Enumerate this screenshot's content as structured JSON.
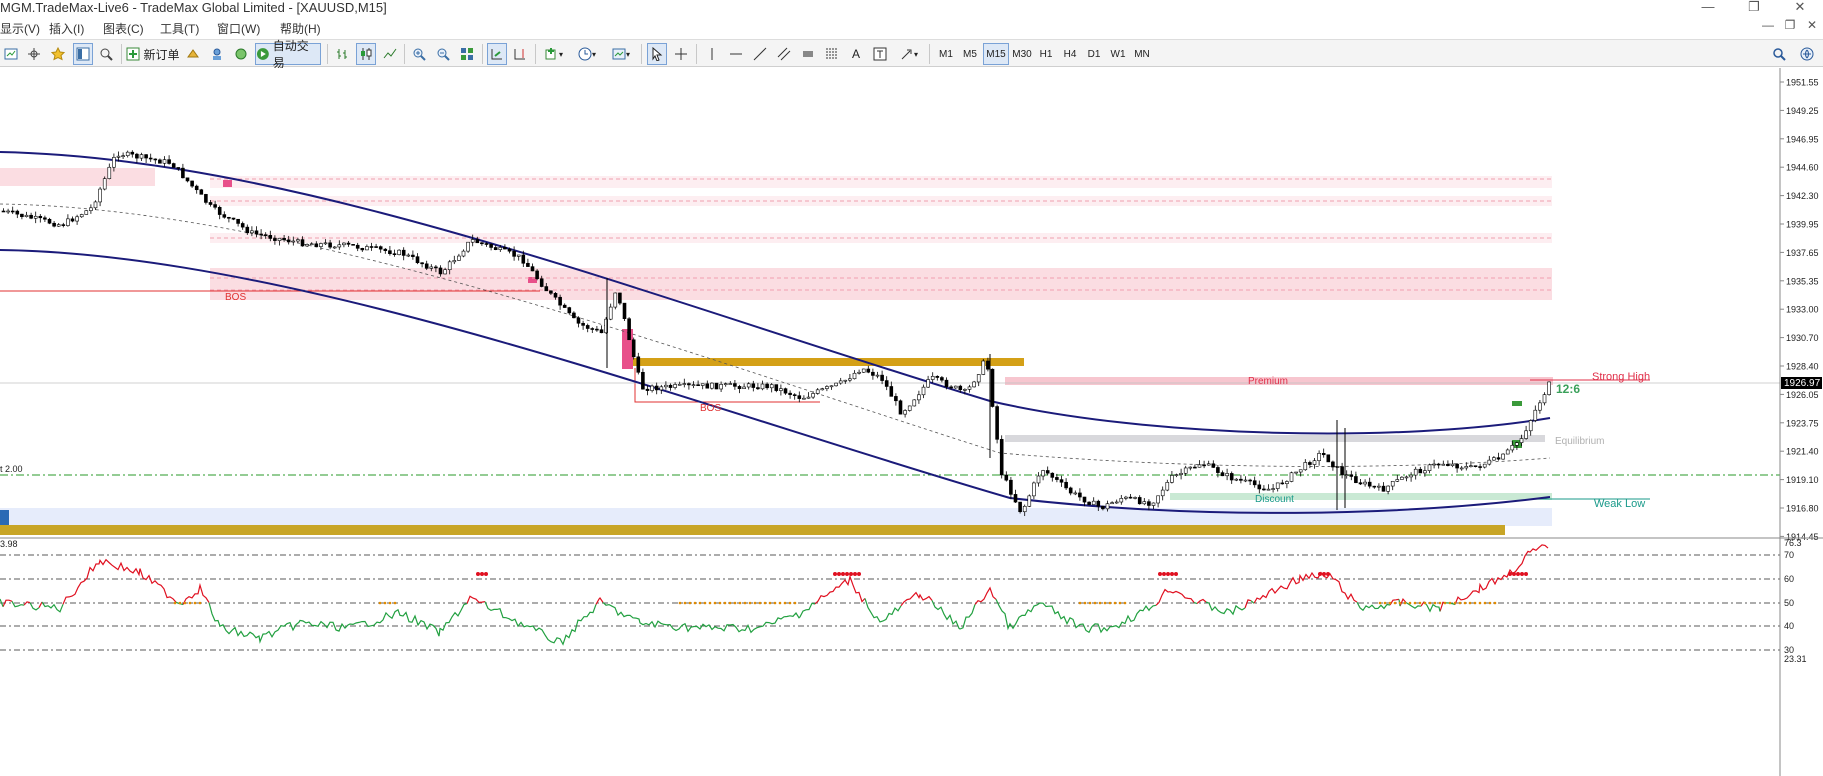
{
  "window": {
    "title": "MGM.TradeMax-Live6 - TradeMax Global Limited - [XAUUSD,M15]",
    "buttons": [
      "—",
      "❐",
      "✕"
    ],
    "mdi_buttons": [
      "—",
      "❐",
      "✕"
    ]
  },
  "menu": {
    "items": [
      "显示(V)",
      "插入(I)",
      "图表(C)",
      "工具(T)",
      "窗口(W)",
      "帮助(H)"
    ]
  },
  "toolbar": {
    "new_order_label": "新订单",
    "auto_trade_label": "自动交易",
    "timeframes": [
      "M1",
      "M5",
      "M15",
      "M30",
      "H1",
      "H4",
      "D1",
      "W1",
      "MN"
    ],
    "active_timeframe": "M15"
  },
  "chart": {
    "symbol": "XAUUSD",
    "timeframe": "M15",
    "current_price": "1926.97",
    "countdown": "12:6",
    "price_ticks": [
      "1951.55",
      "1949.25",
      "1946.95",
      "1944.60",
      "1942.30",
      "1939.95",
      "1937.65",
      "1935.35",
      "1933.00",
      "1930.70",
      "1928.40",
      "1926.05",
      "1923.75",
      "1921.40",
      "1919.10",
      "1916.80",
      "1914.45"
    ],
    "labels": {
      "bos_upper": "BOS",
      "bos_lower": "BOS",
      "premium": "Premium",
      "equilibrium": "Equilibrium",
      "discount": "Discount",
      "strong_high": "Strong High",
      "weak_low": "Weak Low",
      "left_level": "t 2.00"
    },
    "colors": {
      "bull_candle": "#ffffff",
      "bear_candle": "#000000",
      "channel": "#1b1b7a",
      "bos_line": "#e03030",
      "order_block": "#d4a017",
      "premium_zone": "#f7c6cf",
      "discount_zone": "#c9e9d4",
      "strong_high": "#e0304a",
      "weak_low": "#1a9a8a"
    }
  },
  "indicator": {
    "left_value": "3.98",
    "current_value": "76.3",
    "min_value": "23.31",
    "levels": [
      "70",
      "60",
      "50",
      "40",
      "30"
    ],
    "colors": {
      "up": "#e01020",
      "down": "#22a040"
    }
  }
}
